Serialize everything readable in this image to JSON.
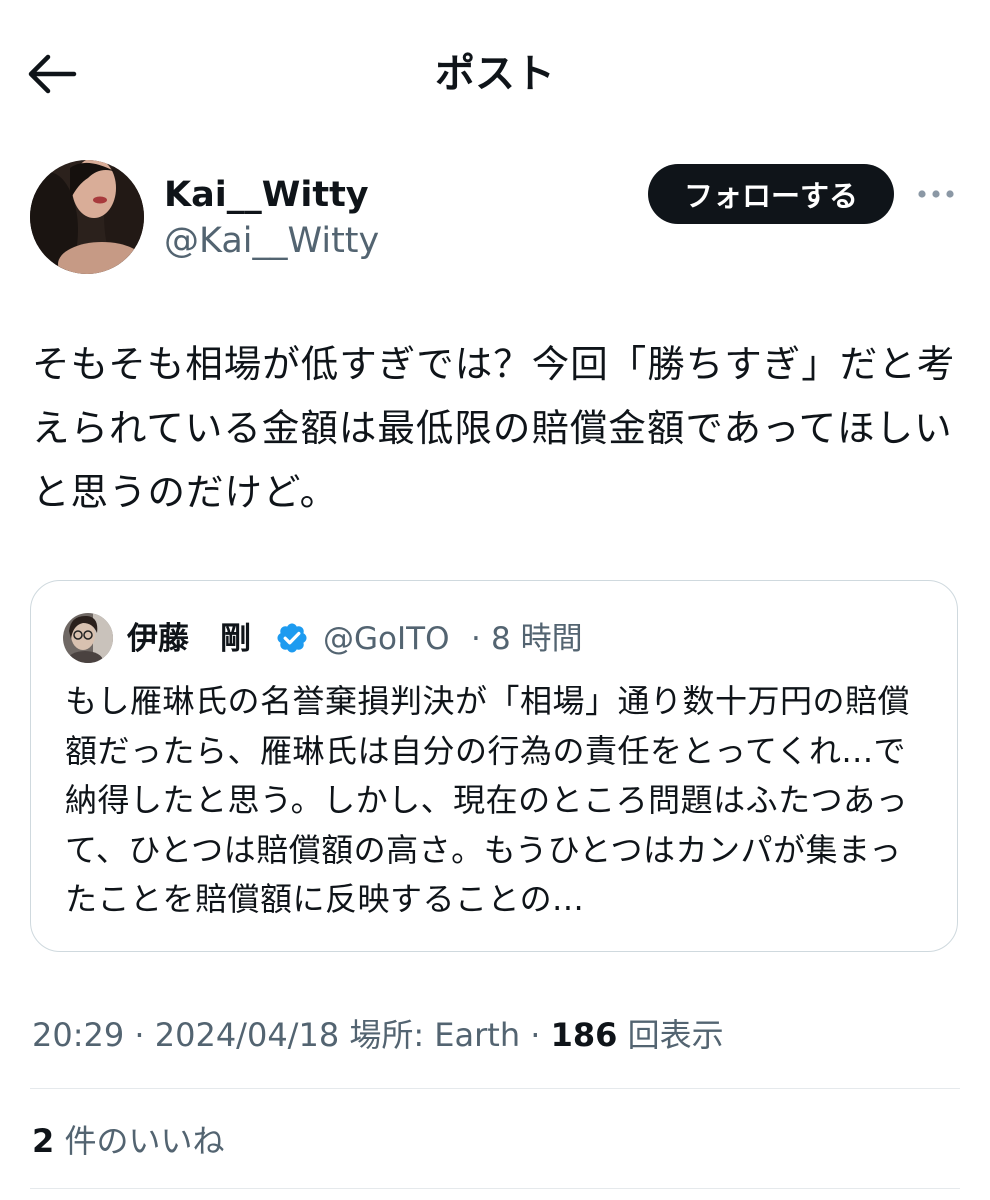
{
  "header": {
    "title": "ポスト",
    "back_icon": "arrow-left-icon"
  },
  "author": {
    "display_name": "Kai__Witty",
    "handle": "@Kai__Witty",
    "follow_label": "フォローする",
    "more_icon": "ellipsis-icon"
  },
  "post": {
    "text": "そもそも相場が低すぎでは？今回「勝ちすぎ」だと考えられている金額は最低限の賠償金額であってほしいと思うのだけど。"
  },
  "quote": {
    "name": "伊藤　剛",
    "verified_icon": "verified-badge-icon",
    "handle": "@GoITO",
    "separator": "·",
    "time": "8 時間",
    "text": "もし雁琳氏の名誉棄損判決が「相場」通り数十万円の賠償額だったら、雁琳氏は自分の行為の責任をとってくれ...で納得したと思う。しかし、現在のところ問題はふたつあって、ひとつは賠償額の高さ。もうひとつはカンパが集まったことを賠償額に反映することの..."
  },
  "meta": {
    "time": "20:29",
    "sep1": " · ",
    "date": "2024/04/18",
    "location": " 場所: Earth",
    "sep2": " · ",
    "views": "186",
    "views_label": " 回表示"
  },
  "likes": {
    "count": "2",
    "label": " 件のいいね"
  },
  "colors": {
    "text": "#0f1419",
    "secondary": "#536471",
    "verified": "#1d9bf0",
    "border": "#cfd9de"
  }
}
